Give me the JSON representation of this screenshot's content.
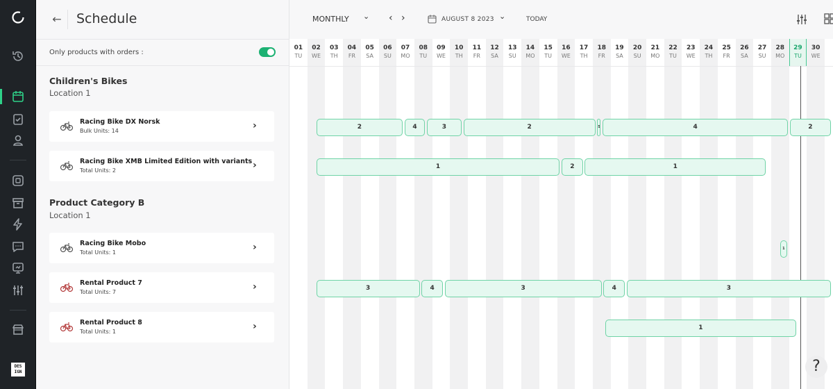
{
  "header": {
    "title": "Schedule",
    "filter_label": "Only products with orders :",
    "view_mode": "MONTHLY",
    "date": "AUGUST 8 2023",
    "today_label": "TODAY"
  },
  "categories": [
    {
      "title": "Children's Bikes",
      "location": "Location 1",
      "products": [
        {
          "name": "Racing Bike DX Norsk",
          "units": "Bulk Units: 14",
          "icon": "bike-icon"
        },
        {
          "name": "Racing Bike XMB Limited Edition with variants",
          "units": "Total Units: 2",
          "icon": "bike-icon"
        }
      ]
    },
    {
      "title": "Product Category B",
      "location": "Location 1",
      "products": [
        {
          "name": "Racing Bike Mobo",
          "units": "Total Units: 1",
          "icon": "bike-icon"
        },
        {
          "name": "Rental Product 7",
          "units": "Total Units: 7",
          "icon": "bike-icon-red"
        },
        {
          "name": "Rental Product 8",
          "units": "Total Units: 1",
          "icon": "bike-icon-red"
        }
      ]
    }
  ],
  "days": [
    {
      "num": "01",
      "dow": "TU"
    },
    {
      "num": "02",
      "dow": "WE"
    },
    {
      "num": "03",
      "dow": "TH"
    },
    {
      "num": "04",
      "dow": "FR"
    },
    {
      "num": "05",
      "dow": "SA"
    },
    {
      "num": "06",
      "dow": "SU"
    },
    {
      "num": "07",
      "dow": "MO"
    },
    {
      "num": "08",
      "dow": "TU"
    },
    {
      "num": "09",
      "dow": "WE"
    },
    {
      "num": "10",
      "dow": "TH"
    },
    {
      "num": "11",
      "dow": "FR"
    },
    {
      "num": "12",
      "dow": "SA"
    },
    {
      "num": "13",
      "dow": "SU"
    },
    {
      "num": "14",
      "dow": "MO"
    },
    {
      "num": "15",
      "dow": "TU"
    },
    {
      "num": "16",
      "dow": "WE"
    },
    {
      "num": "17",
      "dow": "TH"
    },
    {
      "num": "18",
      "dow": "FR"
    },
    {
      "num": "19",
      "dow": "SA"
    },
    {
      "num": "20",
      "dow": "SU"
    },
    {
      "num": "21",
      "dow": "MO"
    },
    {
      "num": "22",
      "dow": "TU"
    },
    {
      "num": "23",
      "dow": "WE"
    },
    {
      "num": "24",
      "dow": "TH"
    },
    {
      "num": "25",
      "dow": "FR"
    },
    {
      "num": "26",
      "dow": "SA"
    },
    {
      "num": "27",
      "dow": "SU"
    },
    {
      "num": "28",
      "dow": "MO"
    },
    {
      "num": "29",
      "dow": "TU"
    },
    {
      "num": "30",
      "dow": "WE"
    }
  ],
  "today_index": 28,
  "bookings": [
    {
      "row": 0,
      "start": 1.5,
      "end": 6.35,
      "label": "2"
    },
    {
      "row": 0,
      "start": 6.45,
      "end": 7.6,
      "label": "4"
    },
    {
      "row": 0,
      "start": 7.7,
      "end": 9.65,
      "label": "3"
    },
    {
      "row": 0,
      "start": 9.75,
      "end": 17.15,
      "label": "2"
    },
    {
      "row": 0,
      "start": 17.25,
      "end": 17.45,
      "label": "5"
    },
    {
      "row": 0,
      "start": 17.55,
      "end": 27.95,
      "label": "4"
    },
    {
      "row": 0,
      "start": 28.05,
      "end": 30.35,
      "label": "2"
    },
    {
      "row": 1,
      "start": 1.5,
      "end": 15.15,
      "label": "1"
    },
    {
      "row": 1,
      "start": 15.25,
      "end": 16.45,
      "label": "2"
    },
    {
      "row": 1,
      "start": 16.55,
      "end": 26.7,
      "label": "1"
    },
    {
      "row": 2,
      "start": 27.5,
      "end": 27.9,
      "label": "1"
    },
    {
      "row": 3,
      "start": 1.5,
      "end": 7.3,
      "label": "3"
    },
    {
      "row": 3,
      "start": 7.4,
      "end": 8.6,
      "label": "4"
    },
    {
      "row": 3,
      "start": 8.7,
      "end": 17.5,
      "label": "3"
    },
    {
      "row": 3,
      "start": 17.6,
      "end": 18.8,
      "label": "4"
    },
    {
      "row": 3,
      "start": 18.9,
      "end": 30.35,
      "label": "3"
    },
    {
      "row": 4,
      "start": 17.7,
      "end": 28.4,
      "label": "1"
    }
  ],
  "help_label": "?",
  "brand_text": "DES IGN",
  "colors": {
    "accent": "#1db173",
    "booking_fill": "#e5f8f0",
    "booking_border": "#6fd3a6",
    "rail": "#1f2327"
  }
}
